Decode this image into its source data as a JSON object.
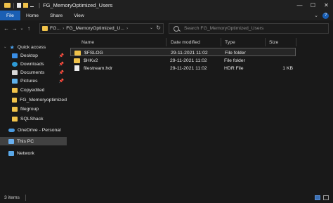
{
  "window": {
    "title": "FG_MemoryOptimized_Users",
    "pipe": "|",
    "controls": {
      "minimize": "—",
      "maximize": "☐",
      "close": "✕"
    }
  },
  "ribbon": {
    "tabs": [
      "File",
      "Home",
      "Share",
      "View"
    ],
    "expand": "⌄",
    "help": "?"
  },
  "nav_buttons": {
    "back": "←",
    "forward": "→",
    "recent": "⌄",
    "up": "↑"
  },
  "address": {
    "segments": [
      "FG...",
      "FG_MemoryOptimized_U..."
    ],
    "chevron": "›",
    "dropdown": "⌄",
    "refresh": "↻"
  },
  "search": {
    "placeholder": "Search FG_MemoryOptimized_Users"
  },
  "navpane": {
    "quick_access": "Quick access",
    "items": [
      {
        "label": "Desktop",
        "icon": "desktop-icon",
        "pinned": true
      },
      {
        "label": "Downloads",
        "icon": "downloads-icon",
        "pinned": true
      },
      {
        "label": "Documents",
        "icon": "documents-icon",
        "pinned": true
      },
      {
        "label": "Pictures",
        "icon": "pictures-icon",
        "pinned": true
      },
      {
        "label": "Copyedited",
        "icon": "folder-icon",
        "pinned": false
      },
      {
        "label": "FG_Memoryoptimized",
        "icon": "folder-icon",
        "pinned": false
      },
      {
        "label": "filegroup",
        "icon": "folder-icon",
        "pinned": false
      },
      {
        "label": "SQLShack",
        "icon": "folder-icon",
        "pinned": false
      }
    ],
    "onedrive": "OneDrive - Personal",
    "this_pc": "This PC",
    "network": "Network",
    "pin_glyph": "📌"
  },
  "columns": {
    "name": "Name",
    "date": "Date modified",
    "type": "Type",
    "size": "Size"
  },
  "files": [
    {
      "name": "$FSLOG",
      "date": "29-11-2021 11:02",
      "type": "File folder",
      "size": "",
      "kind": "folder"
    },
    {
      "name": "$HKv2",
      "date": "29-11-2021 11:02",
      "type": "File folder",
      "size": "",
      "kind": "folder"
    },
    {
      "name": "filestream.hdr",
      "date": "29-11-2021 11:02",
      "type": "HDR File",
      "size": "1 KB",
      "kind": "file"
    }
  ],
  "status": {
    "count": "3 items"
  },
  "colors": {
    "accent": "#1a5fb4",
    "folder": "#f0c24a",
    "background": "#191919"
  }
}
